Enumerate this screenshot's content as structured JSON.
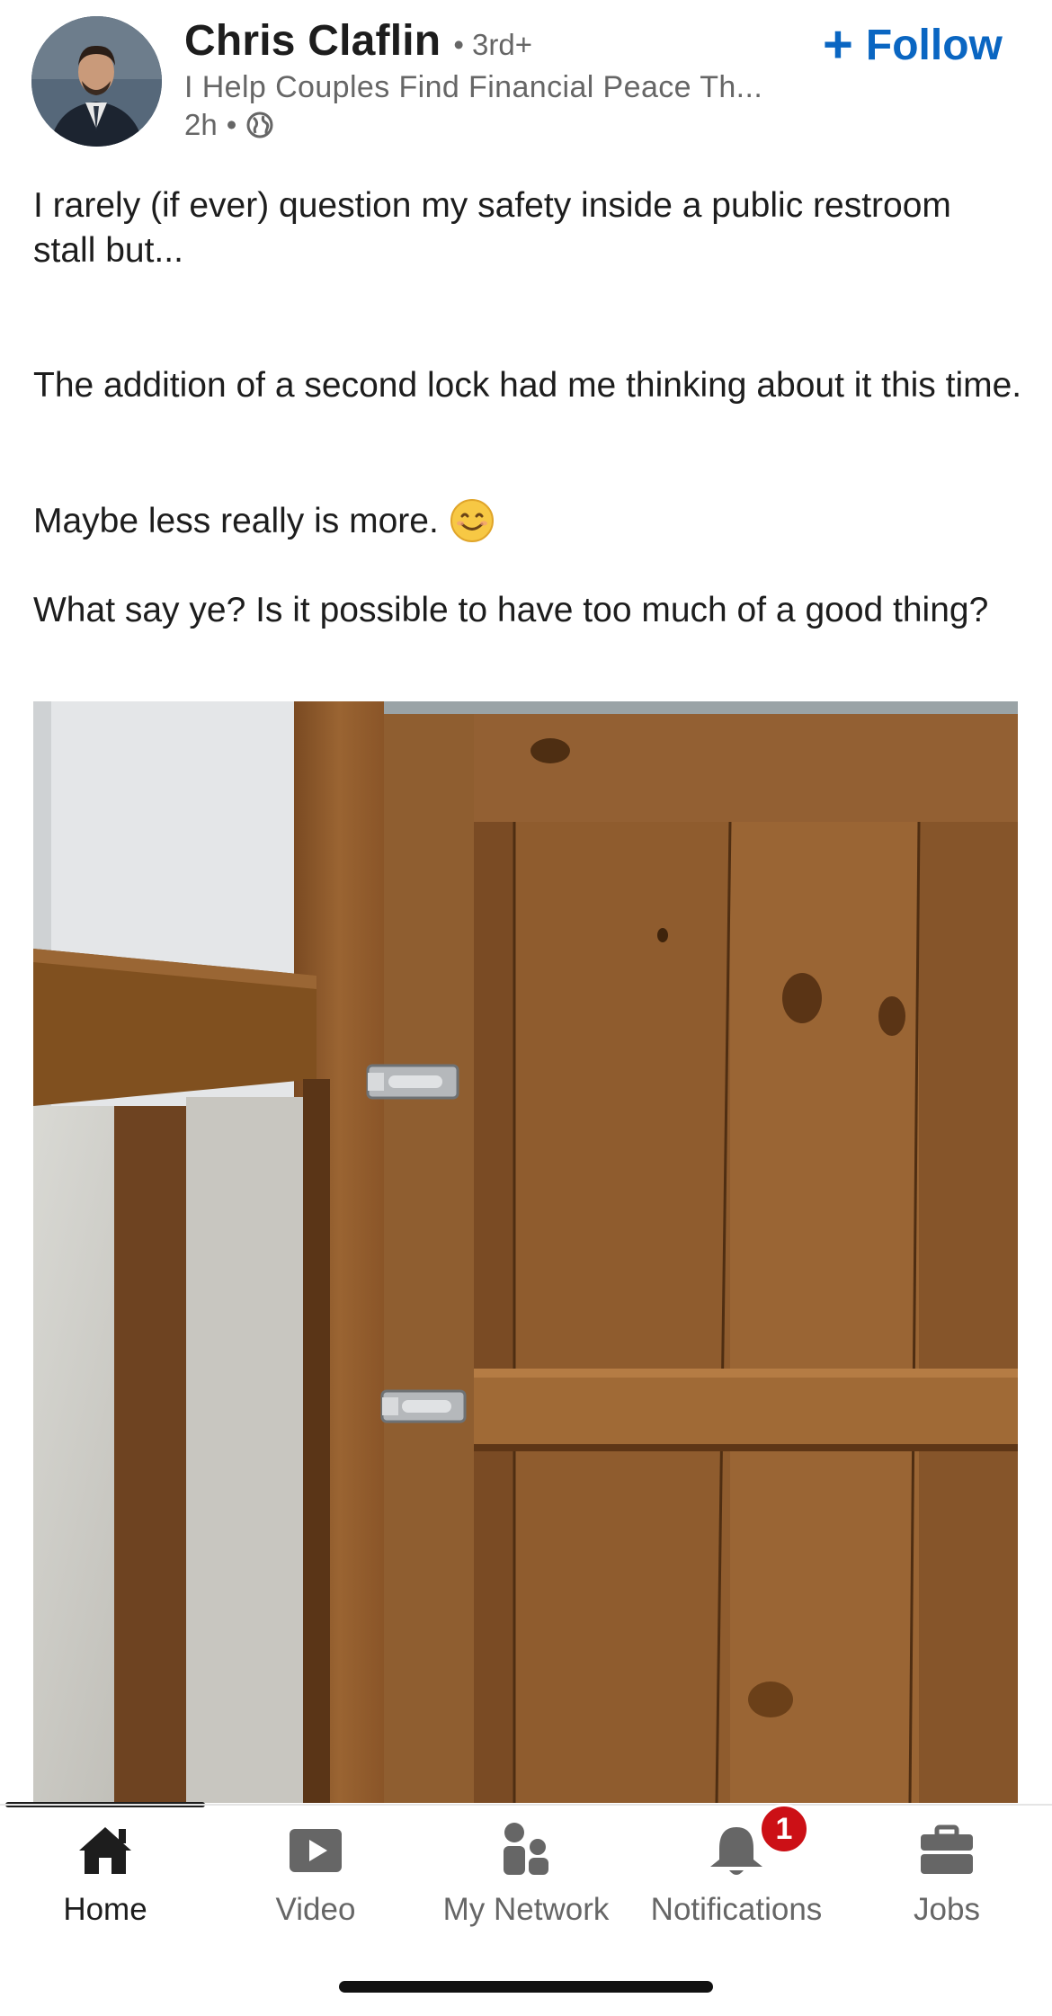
{
  "post": {
    "author_name": "Chris Claflin",
    "degree": "• 3rd+",
    "headline": "I Help Couples Find Financial Peace Th...",
    "time": "2h",
    "meta_dot": "•",
    "visibility_icon": "globe-icon",
    "follow_plus": "+",
    "follow_label": "Follow",
    "text": {
      "p1": "I rarely (if ever) question my safety inside a public restroom stall but...",
      "p2": "The addition of a second lock had me thinking about it this time.",
      "p3": "Maybe less really is more.",
      "p3_emoji": "smiling-face-emoji",
      "p4": "What say ye? Is it possible to have too much of a good thing?"
    },
    "image": "restroom-stall-door-two-locks-photo"
  },
  "tab_bar": {
    "items": [
      {
        "label": "Home",
        "icon": "home-icon",
        "active": true
      },
      {
        "label": "Video",
        "icon": "video-icon",
        "active": false
      },
      {
        "label": "My Network",
        "icon": "network-icon",
        "active": false
      },
      {
        "label": "Notifications",
        "icon": "bell-icon",
        "active": false,
        "badge": "1"
      },
      {
        "label": "Jobs",
        "icon": "briefcase-icon",
        "active": false
      }
    ]
  },
  "colors": {
    "accent": "#0a66c2",
    "badge": "#cc1016",
    "text_primary": "#1d1d1d",
    "text_secondary": "#666666"
  }
}
